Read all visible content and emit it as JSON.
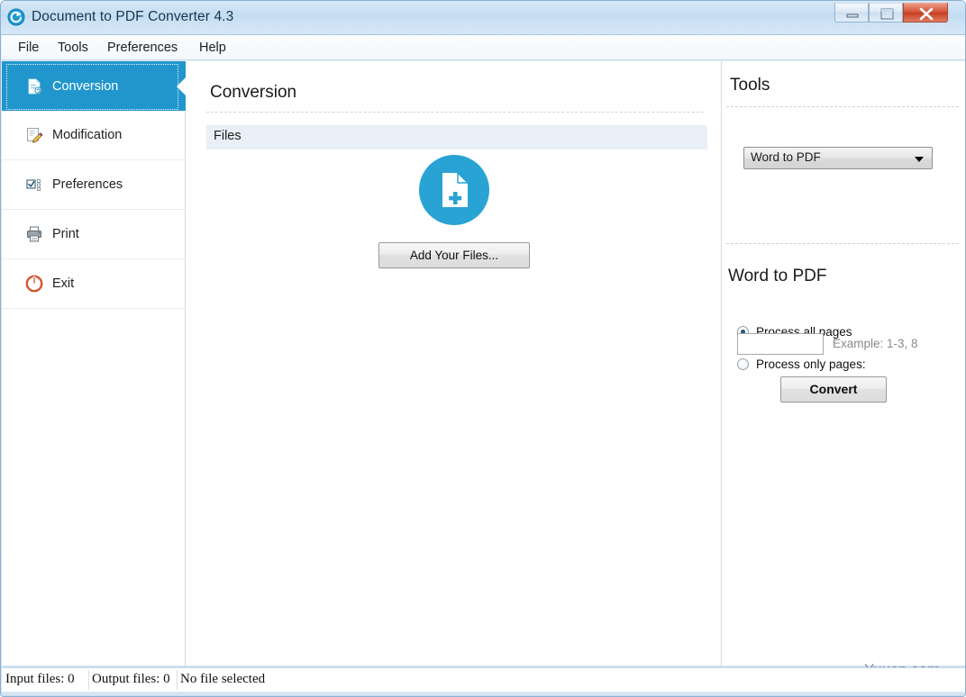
{
  "window": {
    "title": "Document to PDF Converter 4.3",
    "app_icon": "refresh-circle-icon",
    "controls": {
      "minimize": "minimize-button",
      "maximize": "maximize-button",
      "close": "close-button"
    },
    "accent_color": "#2196cd",
    "titlebar_color": "#c9dff3"
  },
  "menubar": {
    "items": [
      {
        "label": "File"
      },
      {
        "label": "Tools"
      },
      {
        "label": "Preferences"
      },
      {
        "label": "Help"
      }
    ]
  },
  "sidebar": {
    "items": [
      {
        "label": "Conversion",
        "icon": "document-convert-icon",
        "selected": true
      },
      {
        "label": "Modification",
        "icon": "page-pencil-icon",
        "selected": false
      },
      {
        "label": "Preferences",
        "icon": "checkbox-list-icon",
        "selected": false
      },
      {
        "label": "Print",
        "icon": "printer-icon",
        "selected": false
      },
      {
        "label": "Exit",
        "icon": "power-icon",
        "selected": false
      }
    ]
  },
  "main": {
    "title": "Conversion",
    "files_section_label": "Files",
    "drop_icon": "add-file-icon",
    "add_files_button": "Add Your Files..."
  },
  "tools": {
    "title": "Tools",
    "selected_tool": "Word to PDF",
    "tool_options": [
      "Word to PDF"
    ],
    "dropdown_icon": "chevron-down-icon",
    "tool_heading": "Word to PDF",
    "radios": [
      {
        "label": "Process all pages",
        "selected": true
      },
      {
        "label": "Process only pages:",
        "selected": false
      }
    ],
    "pages_input_value": "",
    "pages_input_placeholder": "",
    "pages_example": "Example: 1-3, 8",
    "convert_button": "Convert"
  },
  "statusbar": {
    "input_files": "Input files: 0",
    "output_files": "Output files: 0",
    "file_status": "No file selected"
  },
  "watermark": {
    "text": "Yuucn.com"
  }
}
